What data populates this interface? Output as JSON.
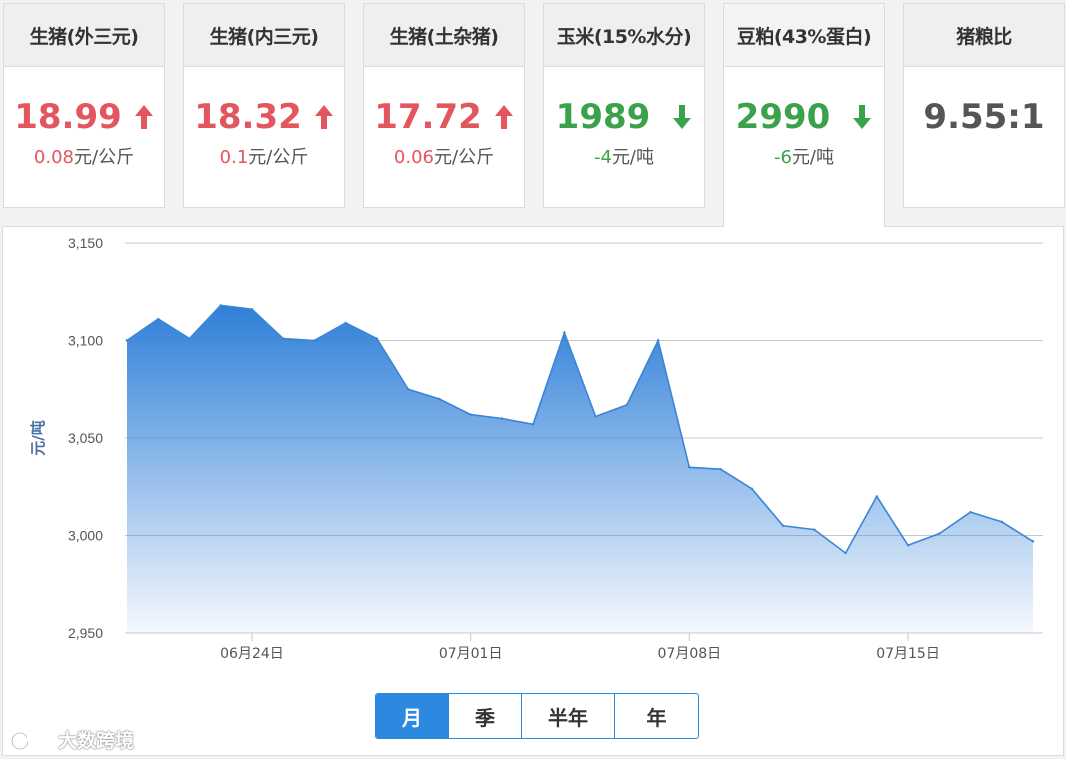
{
  "cards": [
    {
      "title": "生猪(外三元)",
      "price": "18.99",
      "direction": "up",
      "change": "0.08",
      "unit": "元/公斤"
    },
    {
      "title": "生猪(内三元)",
      "price": "18.32",
      "direction": "up",
      "change": "0.1",
      "unit": "元/公斤"
    },
    {
      "title": "生猪(土杂猪)",
      "price": "17.72",
      "direction": "up",
      "change": "0.06",
      "unit": "元/公斤"
    },
    {
      "title": "玉米(15%水分)",
      "price": "1989",
      "direction": "down",
      "change": "-4",
      "unit": "元/吨"
    },
    {
      "title": "豆粕(43%蛋白)",
      "price": "2990",
      "direction": "down",
      "change": "-6",
      "unit": "元/吨"
    },
    {
      "title": "猪粮比",
      "price": "9.55:1",
      "direction": "none",
      "change": "",
      "unit": ""
    }
  ],
  "colors": {
    "up": "#e4565d",
    "down": "#3aa24a",
    "accent": "#2b8ae0",
    "line": "#3a85d6"
  },
  "chart_data": {
    "type": "area",
    "ylabel": "元/吨",
    "ylim": [
      2950,
      3150
    ],
    "yticks": [
      2950,
      3000,
      3050,
      3100,
      3150
    ],
    "ytick_labels": [
      "2,950",
      "3,000",
      "3,050",
      "3,100",
      "3,150"
    ],
    "xtick_labels": [
      "06月24日",
      "07月01日",
      "07月08日",
      "07月15日"
    ],
    "xtick_dates": [
      "06-24",
      "07-01",
      "07-08",
      "07-15"
    ],
    "x": [
      "06-20",
      "06-21",
      "06-22",
      "06-23",
      "06-24",
      "06-25",
      "06-26",
      "06-27",
      "06-28",
      "06-29",
      "06-30",
      "07-01",
      "07-02",
      "07-03",
      "07-04",
      "07-05",
      "07-06",
      "07-07",
      "07-08",
      "07-09",
      "07-10",
      "07-11",
      "07-12",
      "07-13",
      "07-14",
      "07-15",
      "07-16",
      "07-17",
      "07-18",
      "07-19"
    ],
    "values": [
      3100,
      3111,
      3101,
      3118,
      3116,
      3101,
      3100,
      3109,
      3101,
      3075,
      3070,
      3062,
      3060,
      3057,
      3104,
      3061,
      3067,
      3100,
      3035,
      3034,
      3024,
      3005,
      3003,
      2991,
      3020,
      2995,
      3001,
      3012,
      3007,
      2997
    ],
    "grid": true
  },
  "period_tabs": [
    "月",
    "季",
    "半年",
    "年"
  ],
  "active_tab": "月",
  "watermark": "大数跨境"
}
